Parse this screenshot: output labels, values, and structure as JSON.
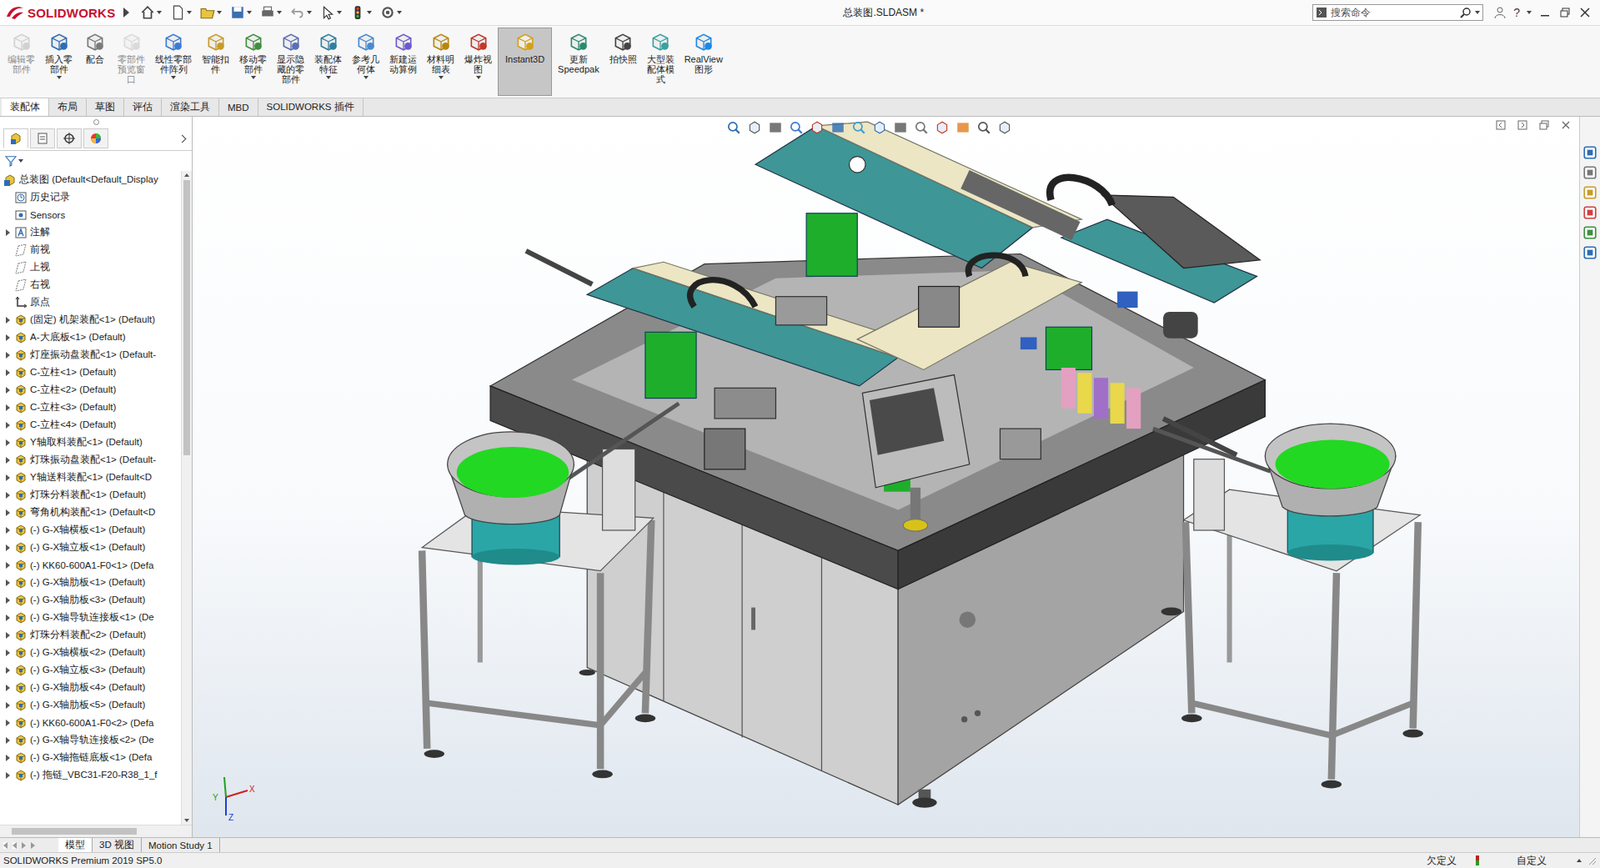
{
  "app": {
    "brand": "SOLIDWORKS",
    "title": "总装图.SLDASM *",
    "search_placeholder": "搜索命令",
    "help": "?"
  },
  "ribbon": [
    {
      "label": "编辑零\n部件",
      "disabled": true,
      "dropdown": false,
      "selected": false
    },
    {
      "label": "插入零\n部件",
      "disabled": false,
      "dropdown": true,
      "selected": false
    },
    {
      "label": "配合",
      "disabled": false,
      "dropdown": false,
      "selected": false
    },
    {
      "label": "零部件\n预览窗\n口",
      "disabled": true,
      "dropdown": false,
      "selected": false
    },
    {
      "label": "线性零部\n件阵列",
      "disabled": false,
      "dropdown": true,
      "selected": false
    },
    {
      "label": "智能扣\n件",
      "disabled": false,
      "dropdown": false,
      "selected": false
    },
    {
      "label": "移动零\n部件",
      "disabled": false,
      "dropdown": true,
      "selected": false
    },
    {
      "label": "显示隐\n藏的零\n部件",
      "disabled": false,
      "dropdown": false,
      "selected": false
    },
    {
      "label": "装配体\n特征",
      "disabled": false,
      "dropdown": true,
      "selected": false
    },
    {
      "label": "参考几\n何体",
      "disabled": false,
      "dropdown": true,
      "selected": false
    },
    {
      "label": "新建运\n动算例",
      "disabled": false,
      "dropdown": false,
      "selected": false
    },
    {
      "label": "材料明\n细表",
      "disabled": false,
      "dropdown": true,
      "selected": false
    },
    {
      "label": "爆炸视\n图",
      "disabled": false,
      "dropdown": true,
      "selected": false
    },
    {
      "label": "Instant3D",
      "disabled": false,
      "dropdown": false,
      "selected": true
    },
    {
      "label": "更新\nSpeedpak",
      "disabled": false,
      "dropdown": false,
      "selected": false
    },
    {
      "label": "拍快照",
      "disabled": false,
      "dropdown": false,
      "selected": false
    },
    {
      "label": "大型装\n配体模\n式",
      "disabled": false,
      "dropdown": false,
      "selected": false
    },
    {
      "label": "RealView\n图形",
      "disabled": false,
      "dropdown": false,
      "selected": false
    }
  ],
  "tabs": [
    {
      "label": "装配体",
      "selected": true
    },
    {
      "label": "布局",
      "selected": false
    },
    {
      "label": "草图",
      "selected": false
    },
    {
      "label": "评估",
      "selected": false
    },
    {
      "label": "渲染工具",
      "selected": false
    },
    {
      "label": "MBD",
      "selected": false
    },
    {
      "label": "SOLIDWORKS 插件",
      "selected": false
    }
  ],
  "feature_tree": {
    "items": [
      {
        "label": "总装图  (Default<Default_Display",
        "kind": "root",
        "expandable": false
      },
      {
        "label": "历史记录",
        "kind": "history",
        "expandable": false
      },
      {
        "label": "Sensors",
        "kind": "sensor",
        "expandable": false
      },
      {
        "label": "注解",
        "kind": "annotation",
        "expandable": true
      },
      {
        "label": "前视",
        "kind": "plane",
        "expandable": false
      },
      {
        "label": "上视",
        "kind": "plane",
        "expandable": false
      },
      {
        "label": "右视",
        "kind": "plane",
        "expandable": false
      },
      {
        "label": "原点",
        "kind": "origin",
        "expandable": false
      },
      {
        "label": "(固定) 机架装配<1> (Default)",
        "kind": "component",
        "expandable": true
      },
      {
        "label": "A-大底板<1> (Default)",
        "kind": "component",
        "expandable": true
      },
      {
        "label": "灯座振动盘装配<1> (Default-",
        "kind": "component",
        "expandable": true
      },
      {
        "label": "C-立柱<1> (Default)",
        "kind": "component",
        "expandable": true
      },
      {
        "label": "C-立柱<2> (Default)",
        "kind": "component",
        "expandable": true
      },
      {
        "label": "C-立柱<3> (Default)",
        "kind": "component",
        "expandable": true
      },
      {
        "label": "C-立柱<4> (Default)",
        "kind": "component",
        "expandable": true
      },
      {
        "label": "Y轴取料装配<1> (Default)",
        "kind": "component",
        "expandable": true
      },
      {
        "label": "灯珠振动盘装配<1> (Default-",
        "kind": "component",
        "expandable": true
      },
      {
        "label": "Y轴送料装配<1> (Default<D",
        "kind": "component",
        "expandable": true
      },
      {
        "label": "灯珠分料装配<1> (Default)",
        "kind": "component",
        "expandable": true
      },
      {
        "label": "弯角机构装配<1> (Default<D",
        "kind": "component",
        "expandable": true
      },
      {
        "label": "(-) G-X轴横板<1> (Default)",
        "kind": "component",
        "expandable": true
      },
      {
        "label": "(-) G-X轴立板<1> (Default)",
        "kind": "component",
        "expandable": true
      },
      {
        "label": "(-) KK60-600A1-F0<1> (Defa",
        "kind": "component",
        "expandable": true
      },
      {
        "label": "(-) G-X轴肋板<1> (Default)",
        "kind": "component",
        "expandable": true
      },
      {
        "label": "(-) G-X轴肋板<3> (Default)",
        "kind": "component",
        "expandable": true
      },
      {
        "label": "(-) G-X轴导轨连接板<1> (De",
        "kind": "component",
        "expandable": true
      },
      {
        "label": "灯珠分料装配<2> (Default)",
        "kind": "component",
        "expandable": true
      },
      {
        "label": "(-) G-X轴横板<2> (Default)",
        "kind": "component",
        "expandable": true
      },
      {
        "label": "(-) G-X轴立板<3> (Default)",
        "kind": "component",
        "expandable": true
      },
      {
        "label": "(-) G-X轴肋板<4> (Default)",
        "kind": "component",
        "expandable": true
      },
      {
        "label": "(-) G-X轴肋板<5> (Default)",
        "kind": "component",
        "expandable": true
      },
      {
        "label": "(-) KK60-600A1-F0<2> (Defa",
        "kind": "component",
        "expandable": true
      },
      {
        "label": "(-) G-X轴导轨连接板<2> (De",
        "kind": "component",
        "expandable": true
      },
      {
        "label": "(-) G-X轴拖链底板<1> (Defa",
        "kind": "component",
        "expandable": true
      },
      {
        "label": "(-) 拖链_VBC31-F20-R38_1_f",
        "kind": "component",
        "expandable": true
      }
    ]
  },
  "triad": {
    "x": "X",
    "y": "Y",
    "z": "Z"
  },
  "bottom_tabs": [
    {
      "label": "模型",
      "selected": true
    },
    {
      "label": "3D 视图",
      "selected": false
    },
    {
      "label": "Motion Study 1",
      "selected": false
    }
  ],
  "status_bar": {
    "product": "SOLIDWORKS Premium 2019 SP5.0",
    "state": "欠定义",
    "units": "自定义"
  }
}
